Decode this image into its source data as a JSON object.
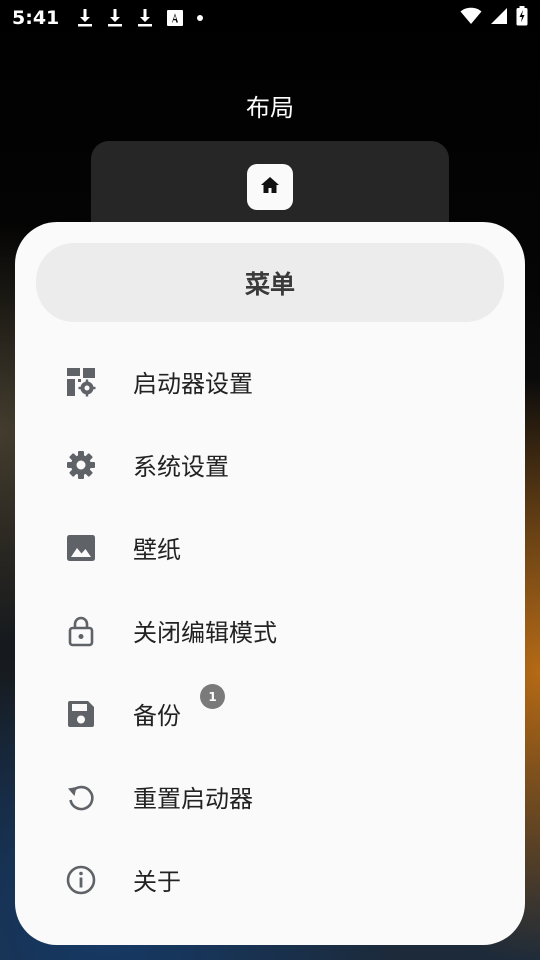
{
  "status_bar": {
    "time": "5:41",
    "notification_icons": [
      "download-icon",
      "download-icon",
      "download-icon",
      "app-notification-icon",
      "dot-icon"
    ],
    "system_icons": [
      "wifi-icon",
      "cellular-signal-icon",
      "battery-charging-icon"
    ]
  },
  "layout": {
    "title": "布局"
  },
  "menu": {
    "title": "菜单",
    "items": [
      {
        "label": "启动器设置",
        "icon": "launcher-settings-icon"
      },
      {
        "label": "系统设置",
        "icon": "gear-icon"
      },
      {
        "label": "壁纸",
        "icon": "image-icon"
      },
      {
        "label": "关闭编辑模式",
        "icon": "lock-icon"
      },
      {
        "label": "备份",
        "icon": "save-icon",
        "badge": "1"
      },
      {
        "label": "重置启动器",
        "icon": "restore-icon"
      },
      {
        "label": "关于",
        "icon": "info-icon"
      }
    ]
  },
  "colors": {
    "sheet_background": "#fafafa",
    "header_background": "#ececec",
    "icon_color": "#5f6368",
    "badge_color": "#7a7a7a"
  }
}
